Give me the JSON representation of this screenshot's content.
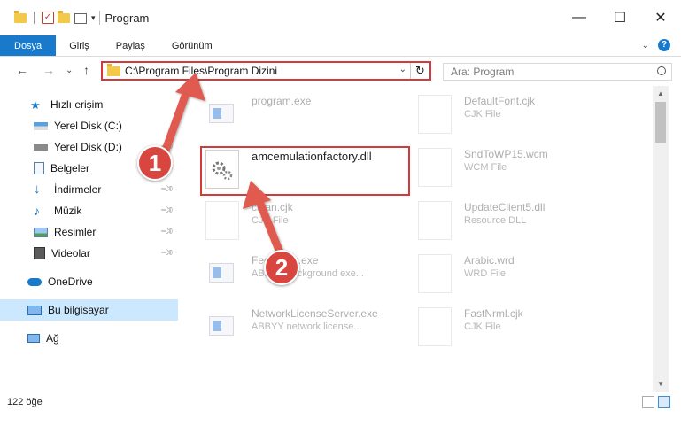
{
  "window": {
    "title": "Program",
    "controls": {
      "minimize": "—",
      "maximize": "☐",
      "close": "✕"
    }
  },
  "ribbon": {
    "tabs": [
      {
        "label": "Dosya",
        "active": true
      },
      {
        "label": "Giriş"
      },
      {
        "label": "Paylaş"
      },
      {
        "label": "Görünüm"
      }
    ],
    "help": "?"
  },
  "nav": {
    "back": "←",
    "forward": "→",
    "recent": "⌄",
    "up": "↑",
    "address": "C:\\Program Files\\Program Dizini",
    "refresh": "↻",
    "search_placeholder": "Ara: Program"
  },
  "sidebar": {
    "quick_access": "Hızlı erişim",
    "items": [
      {
        "label": "Yerel Disk (C:)",
        "icon": "drive-icon",
        "pinned": false
      },
      {
        "label": "Yerel Disk (D:)",
        "icon": "drive-icon",
        "pinned": true
      },
      {
        "label": "Belgeler",
        "icon": "documents-icon",
        "pinned": true
      },
      {
        "label": "İndirmeler",
        "icon": "download-icon",
        "pinned": true
      },
      {
        "label": "Müzik",
        "icon": "music-icon",
        "pinned": true
      },
      {
        "label": "Resimler",
        "icon": "pictures-icon",
        "pinned": true
      },
      {
        "label": "Videolar",
        "icon": "videos-icon",
        "pinned": true
      }
    ],
    "onedrive": "OneDrive",
    "this_pc": "Bu bilgisayar",
    "network": "Ağ"
  },
  "files": {
    "left": [
      {
        "name": "program.exe",
        "type": ""
      },
      {
        "name": "amcemulationfactory.dll",
        "type": ""
      },
      {
        "name": "clean.cjk",
        "type": "CJK File"
      },
      {
        "name": "Feedback.exe",
        "type": "ABBYY background exe..."
      },
      {
        "name": "NetworkLicenseServer.exe",
        "type": "ABBYY network license..."
      }
    ],
    "right": [
      {
        "name": "DefaultFont.cjk",
        "type": "CJK File"
      },
      {
        "name": "SndToWP15.wcm",
        "type": "WCM File"
      },
      {
        "name": "UpdateClient5.dll",
        "type": "Resource DLL"
      },
      {
        "name": "Arabic.wrd",
        "type": "WRD File"
      },
      {
        "name": "FastNrml.cjk",
        "type": "CJK File"
      }
    ]
  },
  "status": {
    "count": "122 öğe"
  },
  "annotations": {
    "step1": "1",
    "step2": "2",
    "color": "#d9463f"
  }
}
